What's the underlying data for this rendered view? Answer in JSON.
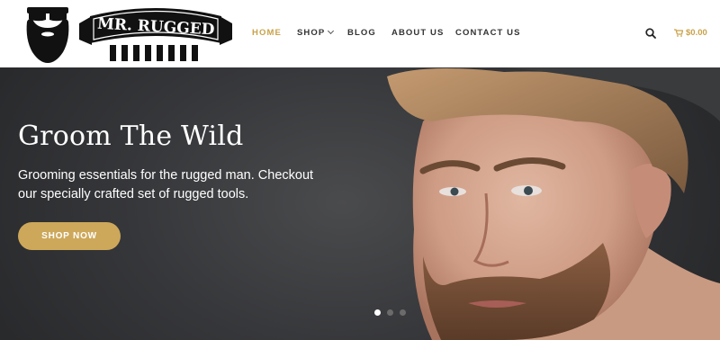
{
  "brand": {
    "logo_text": "MR. RUGGED"
  },
  "nav": {
    "items": [
      {
        "label": "HOME",
        "active": true
      },
      {
        "label": "SHOP",
        "has_dropdown": true
      },
      {
        "label": "BLOG"
      },
      {
        "label": "ABOUT US"
      },
      {
        "label": "CONTACT US"
      }
    ],
    "search_icon": "search-icon",
    "cart_icon": "cart-icon",
    "cart_total": "$0.00"
  },
  "hero": {
    "title": "Groom The Wild",
    "subtitle": "Grooming essentials for the rugged man. Checkout our specially crafted set of rugged tools.",
    "button_label": "SHOP NOW",
    "slides": 3,
    "active_slide": 1
  },
  "colors": {
    "accent": "#c9a24a",
    "button": "#cda85a",
    "hero_bg": "#36373a",
    "text": "#333333"
  }
}
